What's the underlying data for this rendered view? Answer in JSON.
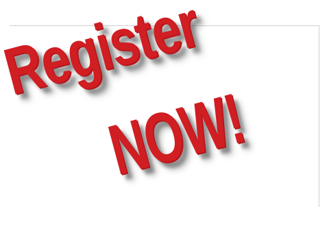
{
  "banner": {
    "line1": "Register",
    "line2": "NOW!"
  },
  "colors": {
    "text": "#d01e22",
    "background": "#ffffff"
  }
}
